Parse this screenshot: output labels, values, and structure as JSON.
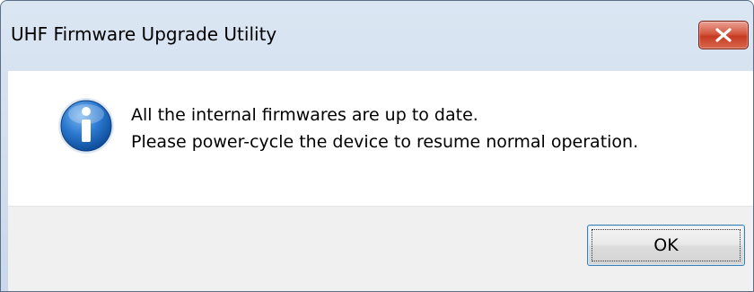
{
  "window": {
    "title": "UHF Firmware Upgrade Utility"
  },
  "dialog": {
    "icon": "information-icon",
    "message_lines": [
      "All the internal firmwares are up to date.",
      "Please power-cycle the device to resume normal operation."
    ],
    "ok_label": "OK"
  },
  "colors": {
    "close_button": "#c63b22",
    "info_icon": "#1f6fc4",
    "focus_border": "#3c7fb1"
  }
}
